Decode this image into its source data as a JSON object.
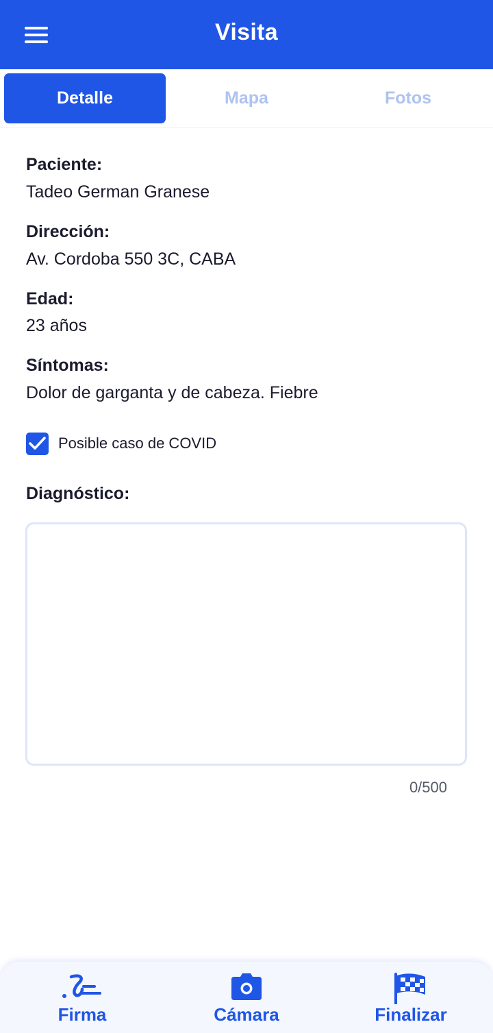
{
  "app_bar": {
    "title": "Visita",
    "menu_icon": "hamburger-menu-icon",
    "background": "#1f56e6"
  },
  "tabs": [
    {
      "label": "Detalle",
      "active": true
    },
    {
      "label": "Mapa",
      "active": false
    },
    {
      "label": "Fotos",
      "active": false
    }
  ],
  "details": {
    "patient_label": "Paciente:",
    "patient_value": "Tadeo German Granese",
    "address_label": "Dirección:",
    "address_value": "Av. Cordoba 550 3C, CABA",
    "age_label": "Edad:",
    "age_value": "23 años",
    "symptoms_label": "Síntomas:",
    "symptoms_value": "Dolor de garganta y de cabeza. Fiebre"
  },
  "covid_checkbox": {
    "label": "Posible caso de COVID",
    "checked": true
  },
  "diagnosis": {
    "label": "Diagnóstico:",
    "value": "",
    "counter": "0/500"
  },
  "bottom_nav": [
    {
      "label": "Firma",
      "icon": "signature-icon"
    },
    {
      "label": "Cámara",
      "icon": "camera-icon"
    },
    {
      "label": "Finalizar",
      "icon": "checkered-flag-icon"
    }
  ],
  "colors": {
    "primary": "#1f56e6",
    "inactive_tab": "#aec3ef",
    "text": "#1b1b2e"
  }
}
